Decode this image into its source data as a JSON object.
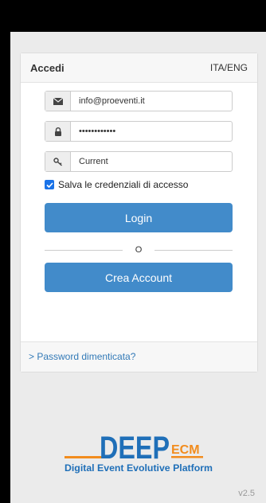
{
  "login": {
    "title": "Accedi",
    "language_toggle": "ITA/ENG",
    "email_value": "info@proeventi.it",
    "password_value": "••••••••••••",
    "context_value": "Current",
    "remember_label": "Salva le credenziali di accesso",
    "login_button": "Login",
    "separator": "O",
    "create_account_button": "Crea Account",
    "forgot_password_link": "> Password dimenticata?"
  },
  "brand": {
    "logo_main": "DEEP",
    "logo_suffix": "ECM",
    "tagline": "Digital Event Evolutive Platform",
    "version": "v2.5",
    "colors": {
      "primary": "#428bca",
      "logo_blue": "#1f6fb8",
      "logo_orange": "#f28c1d"
    }
  },
  "icons": [
    "envelope-icon",
    "lock-icon",
    "key-icon",
    "checkbox-check-icon"
  ]
}
